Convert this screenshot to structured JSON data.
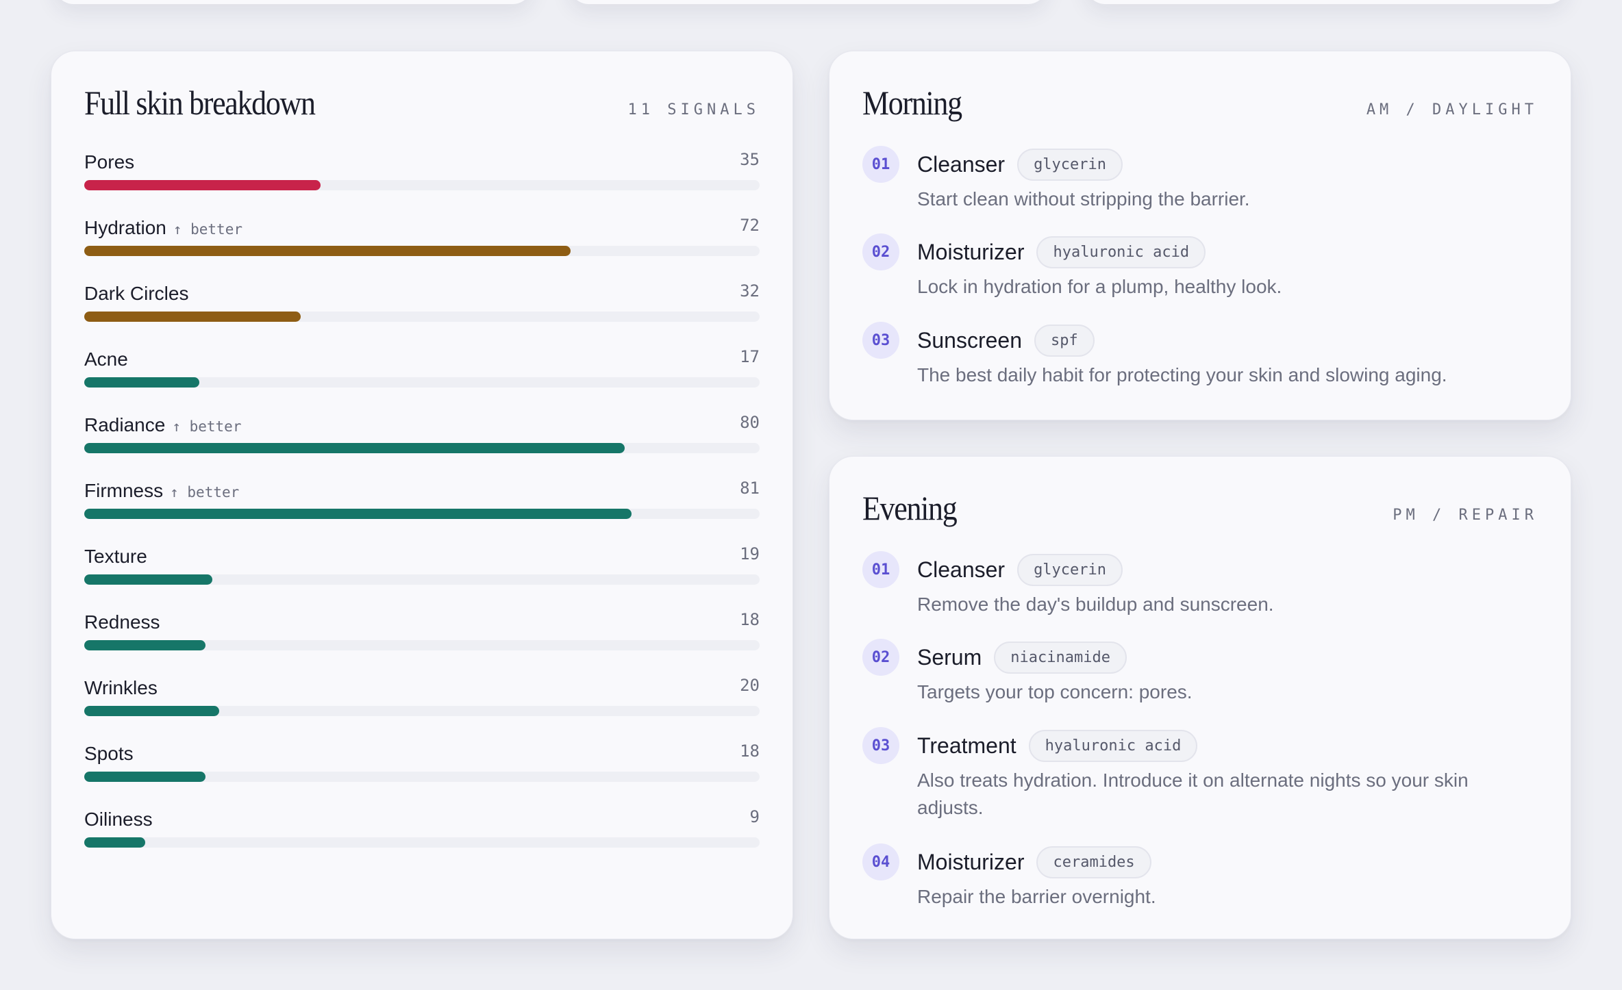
{
  "breakdown": {
    "title": "Full skin breakdown",
    "meta": "11 SIGNALS",
    "metrics": [
      {
        "label": "Pores",
        "trend": "",
        "value": "35",
        "level": 0.35,
        "color": "#c8234a"
      },
      {
        "label": "Hydration",
        "trend": "↑ better",
        "value": "72",
        "level": 0.72,
        "color": "#8e5d14"
      },
      {
        "label": "Dark Circles",
        "trend": "",
        "value": "32",
        "level": 0.32,
        "color": "#8e5d14"
      },
      {
        "label": "Acne",
        "trend": "",
        "value": "17",
        "level": 0.17,
        "color": "#167668"
      },
      {
        "label": "Radiance",
        "trend": "↑ better",
        "value": "80",
        "level": 0.8,
        "color": "#167668"
      },
      {
        "label": "Firmness",
        "trend": "↑ better",
        "value": "81",
        "level": 0.81,
        "color": "#167668"
      },
      {
        "label": "Texture",
        "trend": "",
        "value": "19",
        "level": 0.19,
        "color": "#167668"
      },
      {
        "label": "Redness",
        "trend": "",
        "value": "18",
        "level": 0.18,
        "color": "#167668"
      },
      {
        "label": "Wrinkles",
        "trend": "",
        "value": "20",
        "level": 0.2,
        "color": "#167668"
      },
      {
        "label": "Spots",
        "trend": "",
        "value": "18",
        "level": 0.18,
        "color": "#167668"
      },
      {
        "label": "Oiliness",
        "trend": "",
        "value": "9",
        "level": 0.09,
        "color": "#167668"
      }
    ]
  },
  "morning": {
    "title": "Morning",
    "meta": "AM / DAYLIGHT",
    "steps": [
      {
        "num": "01",
        "name": "Cleanser",
        "ingredient": "glycerin",
        "desc": "Start clean without stripping the barrier."
      },
      {
        "num": "02",
        "name": "Moisturizer",
        "ingredient": "hyaluronic acid",
        "desc": "Lock in hydration for a plump, healthy look."
      },
      {
        "num": "03",
        "name": "Sunscreen",
        "ingredient": "spf",
        "desc": "The best daily habit for protecting your skin and slowing aging."
      }
    ]
  },
  "evening": {
    "title": "Evening",
    "meta": "PM / REPAIR",
    "steps": [
      {
        "num": "01",
        "name": "Cleanser",
        "ingredient": "glycerin",
        "desc": "Remove the day's buildup and sunscreen."
      },
      {
        "num": "02",
        "name": "Serum",
        "ingredient": "niacinamide",
        "desc": "Targets your top concern: pores."
      },
      {
        "num": "03",
        "name": "Treatment",
        "ingredient": "hyaluronic acid",
        "desc": "Also treats hydration. Introduce it on alternate nights so your skin adjusts."
      },
      {
        "num": "04",
        "name": "Moisturizer",
        "ingredient": "ceramides",
        "desc": "Repair the barrier overnight."
      }
    ]
  }
}
